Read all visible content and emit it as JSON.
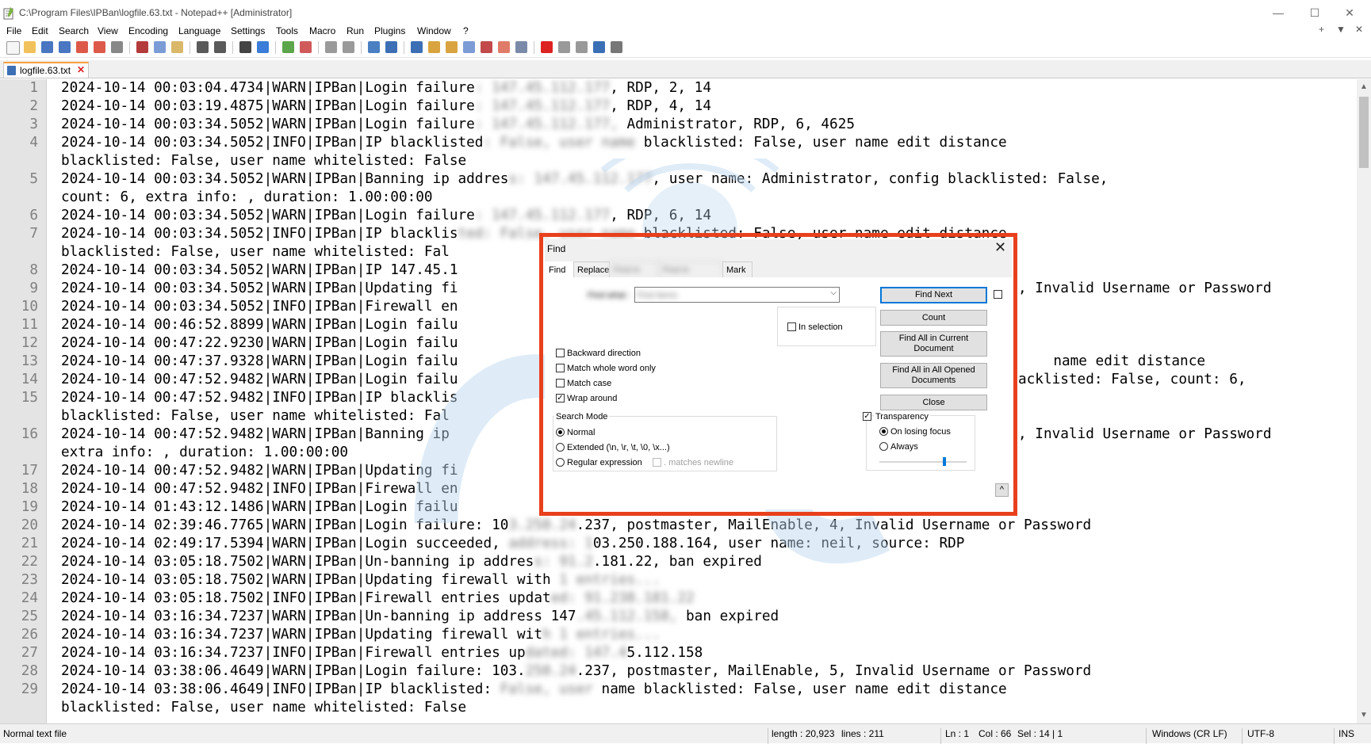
{
  "window": {
    "title": "C:\\Program Files\\IPBan\\logfile.63.txt - Notepad++ [Administrator]",
    "controls": [
      "—",
      "☐",
      "✕"
    ]
  },
  "menu": {
    "items": [
      "File",
      "Edit",
      "Search",
      "View",
      "Encoding",
      "Language",
      "Settings",
      "Tools",
      "Macro",
      "Run",
      "Plugins",
      "Window",
      "?"
    ],
    "right_controls": [
      "+",
      "▼",
      "✕"
    ]
  },
  "tab": {
    "label": "logfile.63.txt"
  },
  "editor": {
    "lines": [
      {
        "n": "1",
        "a": "2024-10-14 00:03:04.4734|WARN|IPBan|Login failure",
        "b": ": 147.45.112.177",
        "c": ", RDP, 2, 14"
      },
      {
        "n": "2",
        "a": "2024-10-14 00:03:19.4875|WARN|IPBan|Login failure",
        "b": ": 147.45.112.177",
        "c": ", RDP, 4, 14"
      },
      {
        "n": "3",
        "a": "2024-10-14 00:03:34.5052|WARN|IPBan|Login failure",
        "b": ": 147.45.112.177,",
        "c": " Administrator, RDP, 6, 4625"
      },
      {
        "n": "4",
        "a": "2024-10-14 00:03:34.5052|INFO|IPBan|IP blacklisted",
        "b": ": False, user name",
        "c": " blacklisted: False, user name edit distance"
      },
      {
        "n": "",
        "a": "blacklisted: False, user name whitelisted: False",
        "b": "",
        "c": ""
      },
      {
        "n": "5",
        "a": "2024-10-14 00:03:34.5052|WARN|IPBan|Banning ip addres",
        "b": "s: 147.45.112.177",
        "c": ", user name: Administrator, config blacklisted: False,"
      },
      {
        "n": "",
        "a": "count: 6, extra info: , duration: 1.00:00:00",
        "b": "",
        "c": ""
      },
      {
        "n": "6",
        "a": "2024-10-14 00:03:34.5052|WARN|IPBan|Login failure",
        "b": ": 147.45.112.177",
        "c": ", RDP, 6, 14"
      },
      {
        "n": "7",
        "a": "2024-10-14 00:03:34.5052|INFO|IPBan|IP blacklis",
        "b": "ted: False, user name",
        "c": " blacklisted: False, user name edit distance"
      },
      {
        "n": "",
        "a": "blacklisted: False, user name whitelisted: Fal",
        "b": "",
        "c": ""
      },
      {
        "n": "8",
        "a": "2024-10-14 00:03:34.5052|WARN|IPBan|IP 147.45.1",
        "b": "",
        "c": ""
      },
      {
        "n": "9",
        "a": "2024-10-14 00:03:34.5052|WARN|IPBan|Updating fi",
        "b": "",
        "c": ""
      },
      {
        "n": "10",
        "a": "2024-10-14 00:03:34.5052|INFO|IPBan|Firewall en",
        "b": "",
        "c": ""
      },
      {
        "n": "11",
        "a": "2024-10-14 00:46:52.8899|WARN|IPBan|Login failu",
        "b": "",
        "c": ""
      },
      {
        "n": "12",
        "a": "2024-10-14 00:47:22.9230|WARN|IPBan|Login failu",
        "b": "",
        "c": ""
      },
      {
        "n": "13",
        "a": "2024-10-14 00:47:37.9328|WARN|IPBan|Login failu",
        "b": "",
        "c": ""
      },
      {
        "n": "14",
        "a": "2024-10-14 00:47:52.9482|WARN|IPBan|Login failu",
        "b": "",
        "c": ""
      },
      {
        "n": "15",
        "a": "2024-10-14 00:47:52.9482|INFO|IPBan|IP blacklis",
        "b": "",
        "c": ""
      },
      {
        "n": "",
        "a": "blacklisted: False, user name whitelisted: Fal",
        "b": "",
        "c": ""
      },
      {
        "n": "16",
        "a": "2024-10-14 00:47:52.9482|WARN|IPBan|Banning ip",
        "b": "",
        "c": ""
      },
      {
        "n": "",
        "a": "extra info: , duration: 1.00:00:00",
        "b": "",
        "c": ""
      },
      {
        "n": "17",
        "a": "2024-10-14 00:47:52.9482|WARN|IPBan|Updating fi",
        "b": "",
        "c": ""
      },
      {
        "n": "18",
        "a": "2024-10-14 00:47:52.9482|INFO|IPBan|Firewall en",
        "b": "",
        "c": ""
      },
      {
        "n": "19",
        "a": "2024-10-14 01:43:12.1486|WARN|IPBan|Login failu",
        "b": "",
        "c": ""
      },
      {
        "n": "20",
        "a": "2024-10-14 02:39:46.7765|WARN|IPBan|Login failure: 10",
        "b": "3.250.24",
        "c": ".237, postmaster, MailEnable, 4, Invalid Username or Password"
      },
      {
        "n": "21",
        "a": "2024-10-14 02:49:17.5394|WARN|IPBan|Login succeeded, ",
        "b": "address: 1",
        "c": "03.250.188.164, user name: neil, source: RDP"
      },
      {
        "n": "22",
        "a": "2024-10-14 03:05:18.7502|WARN|IPBan|Un-banning ip addres",
        "b": "s: 91.2",
        "c": ".181.22, ban expired"
      },
      {
        "n": "23",
        "a": "2024-10-14 03:05:18.7502|WARN|IPBan|Updating firewall with ",
        "b": "1 entries...",
        "c": ""
      },
      {
        "n": "24",
        "a": "2024-10-14 03:05:18.7502|INFO|IPBan|Firewall entries updat",
        "b": "ed: 91.238.181.22",
        "c": ""
      },
      {
        "n": "25",
        "a": "2024-10-14 03:16:34.7237|WARN|IPBan|Un-banning ip address 147",
        "b": ".45.112.158,",
        "c": " ban expired"
      },
      {
        "n": "26",
        "a": "2024-10-14 03:16:34.7237|WARN|IPBan|Updating firewall wit",
        "b": "h 1 entries...",
        "c": ""
      },
      {
        "n": "27",
        "a": "2024-10-14 03:16:34.7237|INFO|IPBan|Firewall entries up",
        "b": "dated: 147.4",
        "c": "5.112.158"
      },
      {
        "n": "28",
        "a": "2024-10-14 03:38:06.4649|WARN|IPBan|Login failure: 103.",
        "b": "250.24",
        "c": ".237, postmaster, MailEnable, 5, Invalid Username or Password"
      },
      {
        "n": "29",
        "a": "2024-10-14 03:38:06.4649|INFO|IPBan|IP blacklisted: ",
        "b": "False, user",
        "c": " name blacklisted: False, user name edit distance"
      },
      {
        "n": "",
        "a": "blacklisted: False, user name whitelisted: False",
        "b": "",
        "c": ""
      }
    ],
    "right_fragments": [
      {
        "row": 11,
        "text": ", Invalid Username or Password"
      },
      {
        "row": 15,
        "text": "name edit distance"
      },
      {
        "row": 16,
        "text": "acklisted: False, count: 6,"
      },
      {
        "row": 19,
        "text": ", Invalid Username or Password"
      }
    ]
  },
  "find_dialog": {
    "title": "Find",
    "tabs": [
      "Find",
      "Replace",
      "Find in Files",
      "Find in Projects",
      "Mark"
    ],
    "find_what_label": "Find what :",
    "find_what_value": "Find Items",
    "buttons": {
      "find_next": "Find Next",
      "count": "Count",
      "find_all_current": "Find All in Current Document",
      "find_all_opened": "Find All in All Opened Documents",
      "close": "Close"
    },
    "in_selection": "In selection",
    "options": {
      "backward": "Backward direction",
      "whole_word": "Match whole word only",
      "match_case": "Match case",
      "wrap_around": "Wrap around"
    },
    "search_mode": {
      "label": "Search Mode",
      "normal": "Normal",
      "extended": "Extended (\\n, \\r, \\t, \\0, \\x...)",
      "regex": "Regular expression",
      "matches_newline": ". matches newline"
    },
    "transparency": {
      "label": "Transparency",
      "on_losing_focus": "On losing focus",
      "always": "Always",
      "level": 0.75
    },
    "collapse": "^",
    "accent": "#e8401c"
  },
  "status": {
    "file_type": "Normal text file",
    "length": "length : 20,923",
    "lines": "lines : 211",
    "ln": "Ln : 1",
    "col": "Col : 66",
    "sel": "Sel : 14 | 1",
    "eol": "Windows (CR LF)",
    "encoding": "UTF-8",
    "ins": "INS"
  }
}
